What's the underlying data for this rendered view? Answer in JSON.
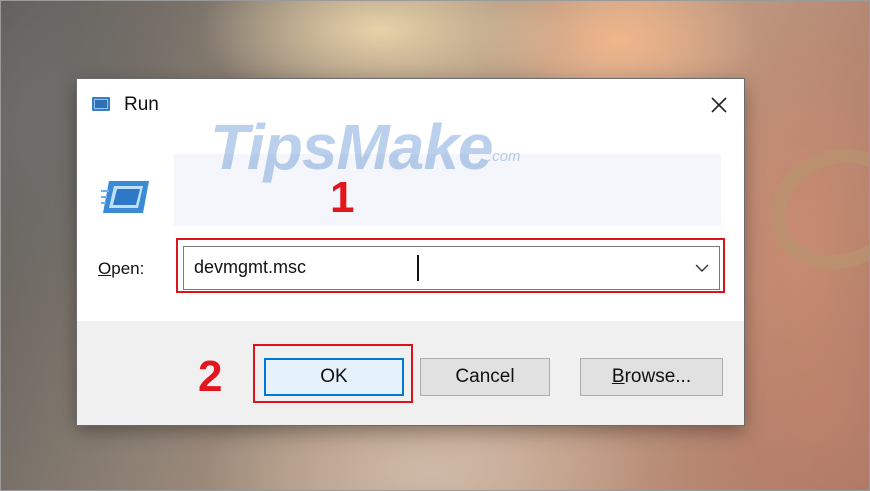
{
  "window": {
    "title": "Run",
    "title_icon": "run-icon",
    "close_icon": "close-icon"
  },
  "dialog": {
    "app_icon": "run-app-icon",
    "open_label_mnemonic": "O",
    "open_label_rest": "pen:",
    "command_value": "devmgmt.msc",
    "dropdown_icon": "chevron-down-icon"
  },
  "buttons": {
    "ok": "OK",
    "cancel": "Cancel",
    "browse_mnemonic": "B",
    "browse_rest": "rowse..."
  },
  "annotations": {
    "step1": "1",
    "step2": "2",
    "highlight_color": "#d9141d"
  },
  "watermark": {
    "brand": "TipsMake",
    "domain": ".com"
  },
  "colors": {
    "accent": "#0078d7",
    "annotation": "#e3151d"
  }
}
